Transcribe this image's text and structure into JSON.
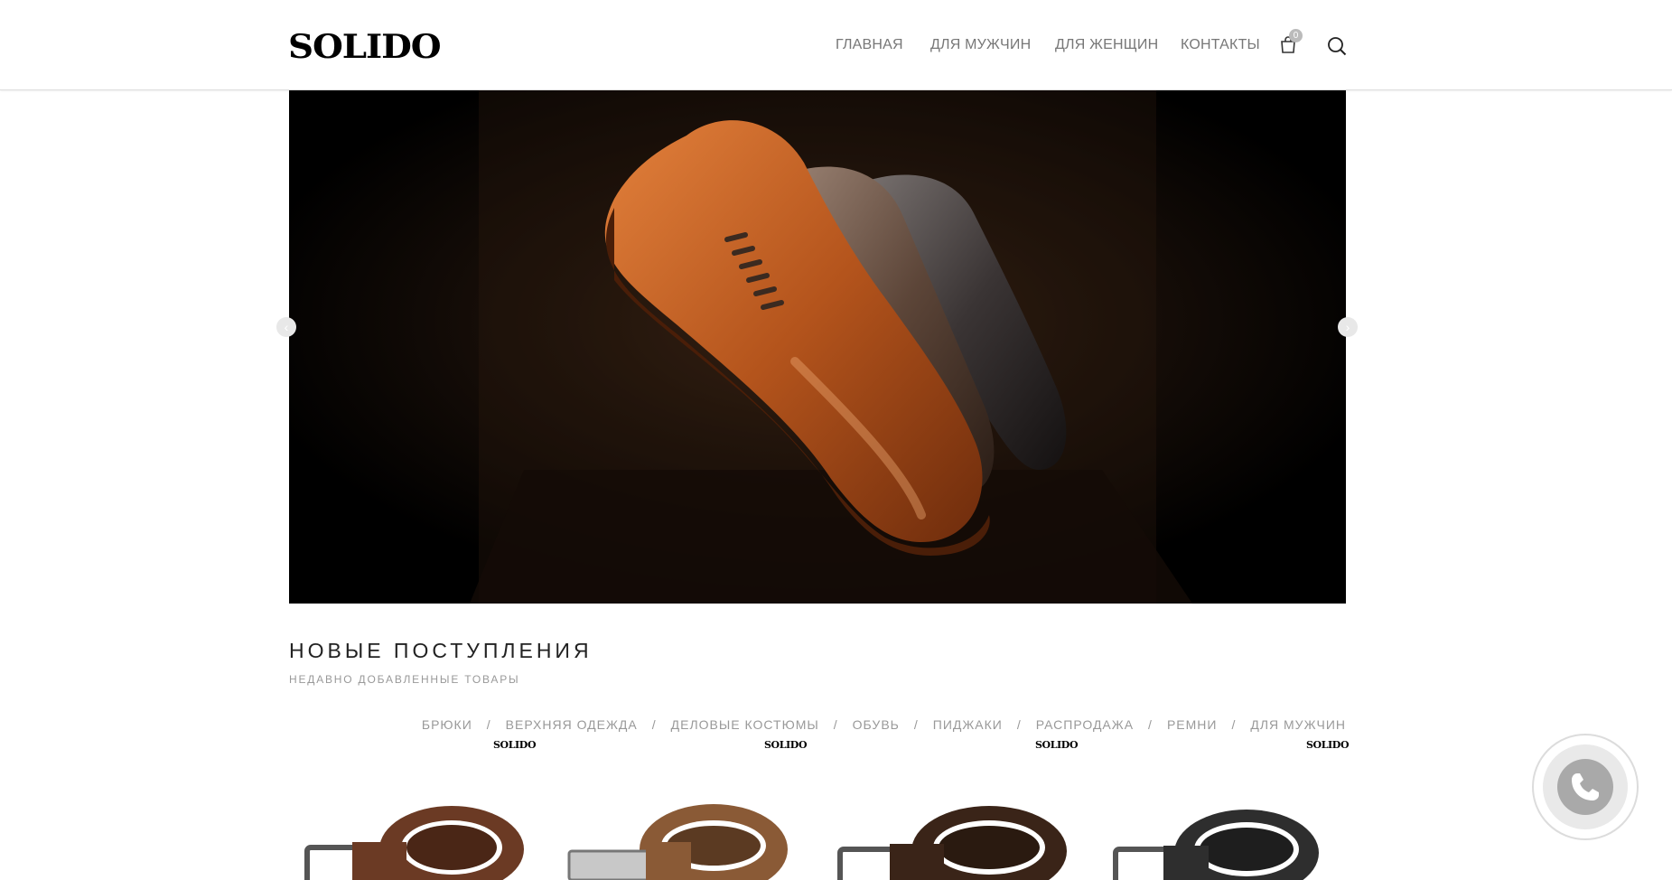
{
  "header": {
    "logo": "SOLIDO",
    "nav": [
      "ГЛАВНАЯ",
      "ДЛЯ МУЖЧИН",
      "ДЛЯ ЖЕНЩИН",
      "КОНТАКТЫ"
    ],
    "cart_count": "0",
    "icons": [
      "shopping-bag-icon",
      "search-icon"
    ]
  },
  "hero": {
    "image": "three leather oxford shoes on dark background",
    "prev_icon": "chevron-left-icon",
    "next_icon": "chevron-right-icon"
  },
  "section": {
    "title": "НОВЫЕ ПОСТУПЛЕНИЯ",
    "subtitle": "НЕДАВНО ДОБАВЛЕННЫЕ ТОВАРЫ"
  },
  "filters": [
    "БРЮКИ",
    "ВЕРХНЯЯ ОДЕЖДА",
    "ДЕЛОВЫЕ КОСТЮМЫ",
    "ОБУВЬ",
    "ПИДЖАКИ",
    "РАСПРОДАЖА",
    "РЕМНИ",
    "ДЛЯ МУЖЧИН"
  ],
  "filter_separator": "/",
  "products": [
    {
      "brand": "SOLIDO",
      "color": "#6b3a24"
    },
    {
      "brand": "SOLIDO",
      "color": "#8a5a36"
    },
    {
      "brand": "SOLIDO",
      "color": "#3a2418"
    },
    {
      "brand": "SOLIDO",
      "color": "#2e2e2e"
    }
  ],
  "call_button": {
    "icon": "phone-icon"
  },
  "colors": {
    "nav_text": "#777777",
    "accent_shoe": "#b4541c",
    "muted": "#999999"
  }
}
